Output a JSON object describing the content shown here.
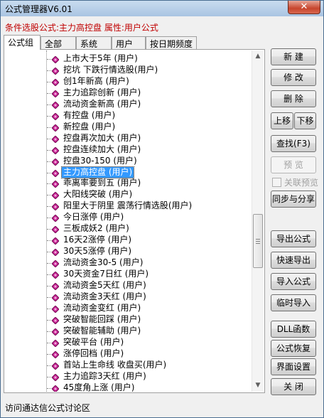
{
  "window": {
    "title": "公式管理器V6.01",
    "close_label": "✕"
  },
  "status_label": "条件选股公式:主力高控盘 属性:用户公式",
  "tabs": [
    "公式组",
    "全部",
    "系统",
    "用户",
    "按日期频度"
  ],
  "tree_items": [
    {
      "label": "上市大于5年   (用户)"
    },
    {
      "label": "挖坑   下跌行情选股(用户)"
    },
    {
      "label": "创1年新高   (用户)"
    },
    {
      "label": "主力追踪创新   (用户)"
    },
    {
      "label": "流动资金新高   (用户)"
    },
    {
      "label": "有控盘   (用户)"
    },
    {
      "label": "新控盘   (用户)"
    },
    {
      "label": "控盘再次加大   (用户)"
    },
    {
      "label": "控盘连续加大   (用户)"
    },
    {
      "label": "控盘30-150   (用户)"
    },
    {
      "label": "主力高控盘   (用户)",
      "selected": true
    },
    {
      "label": "乖离率要到五   (用户)"
    },
    {
      "label": "大阳线突破   (用户)"
    },
    {
      "label": "阳里大于阴里   震荡行情选股(用户)"
    },
    {
      "label": "今日涨停   (用户)"
    },
    {
      "label": "三板成妖2   (用户)"
    },
    {
      "label": "16天2涨停   (用户)"
    },
    {
      "label": "30天5涨停   (用户)"
    },
    {
      "label": "流动资金30-5   (用户)"
    },
    {
      "label": "30天资金7日红   (用户)"
    },
    {
      "label": "流动资金5天红   (用户)"
    },
    {
      "label": "流动资金3天红   (用户)"
    },
    {
      "label": "流动资金变红   (用户)"
    },
    {
      "label": "突破智能回踩   (用户)"
    },
    {
      "label": "突破智能辅助   (用户)"
    },
    {
      "label": "突破平台   (用户)"
    },
    {
      "label": "涨停回档   (用户)"
    },
    {
      "label": "首站上生命线   收盘买(用户)"
    },
    {
      "label": "主力追踪3天红   (用户)"
    },
    {
      "label": "45度角上涨   (用户)"
    }
  ],
  "buttons": {
    "new": "新 建",
    "modify": "修 改",
    "delete": "删 除",
    "move_up": "上移",
    "move_down": "下移",
    "find": "查找(F3)",
    "preview": "预 览",
    "link_preview": "关联预览",
    "sync_share": "同步与分享",
    "export": "导出公式",
    "quick_export": "快速导出",
    "import": "导入公式",
    "temp_import": "临时导入",
    "dll": "DLL函数",
    "restore": "公式恢复",
    "ui_settings": "界面设置",
    "close": "关 闭"
  },
  "footer_link": "访问通达信公式讨论区",
  "colors": {
    "status_text": "#c00000",
    "selection": "#3399ff",
    "icon_magenta": "#c0208f"
  }
}
